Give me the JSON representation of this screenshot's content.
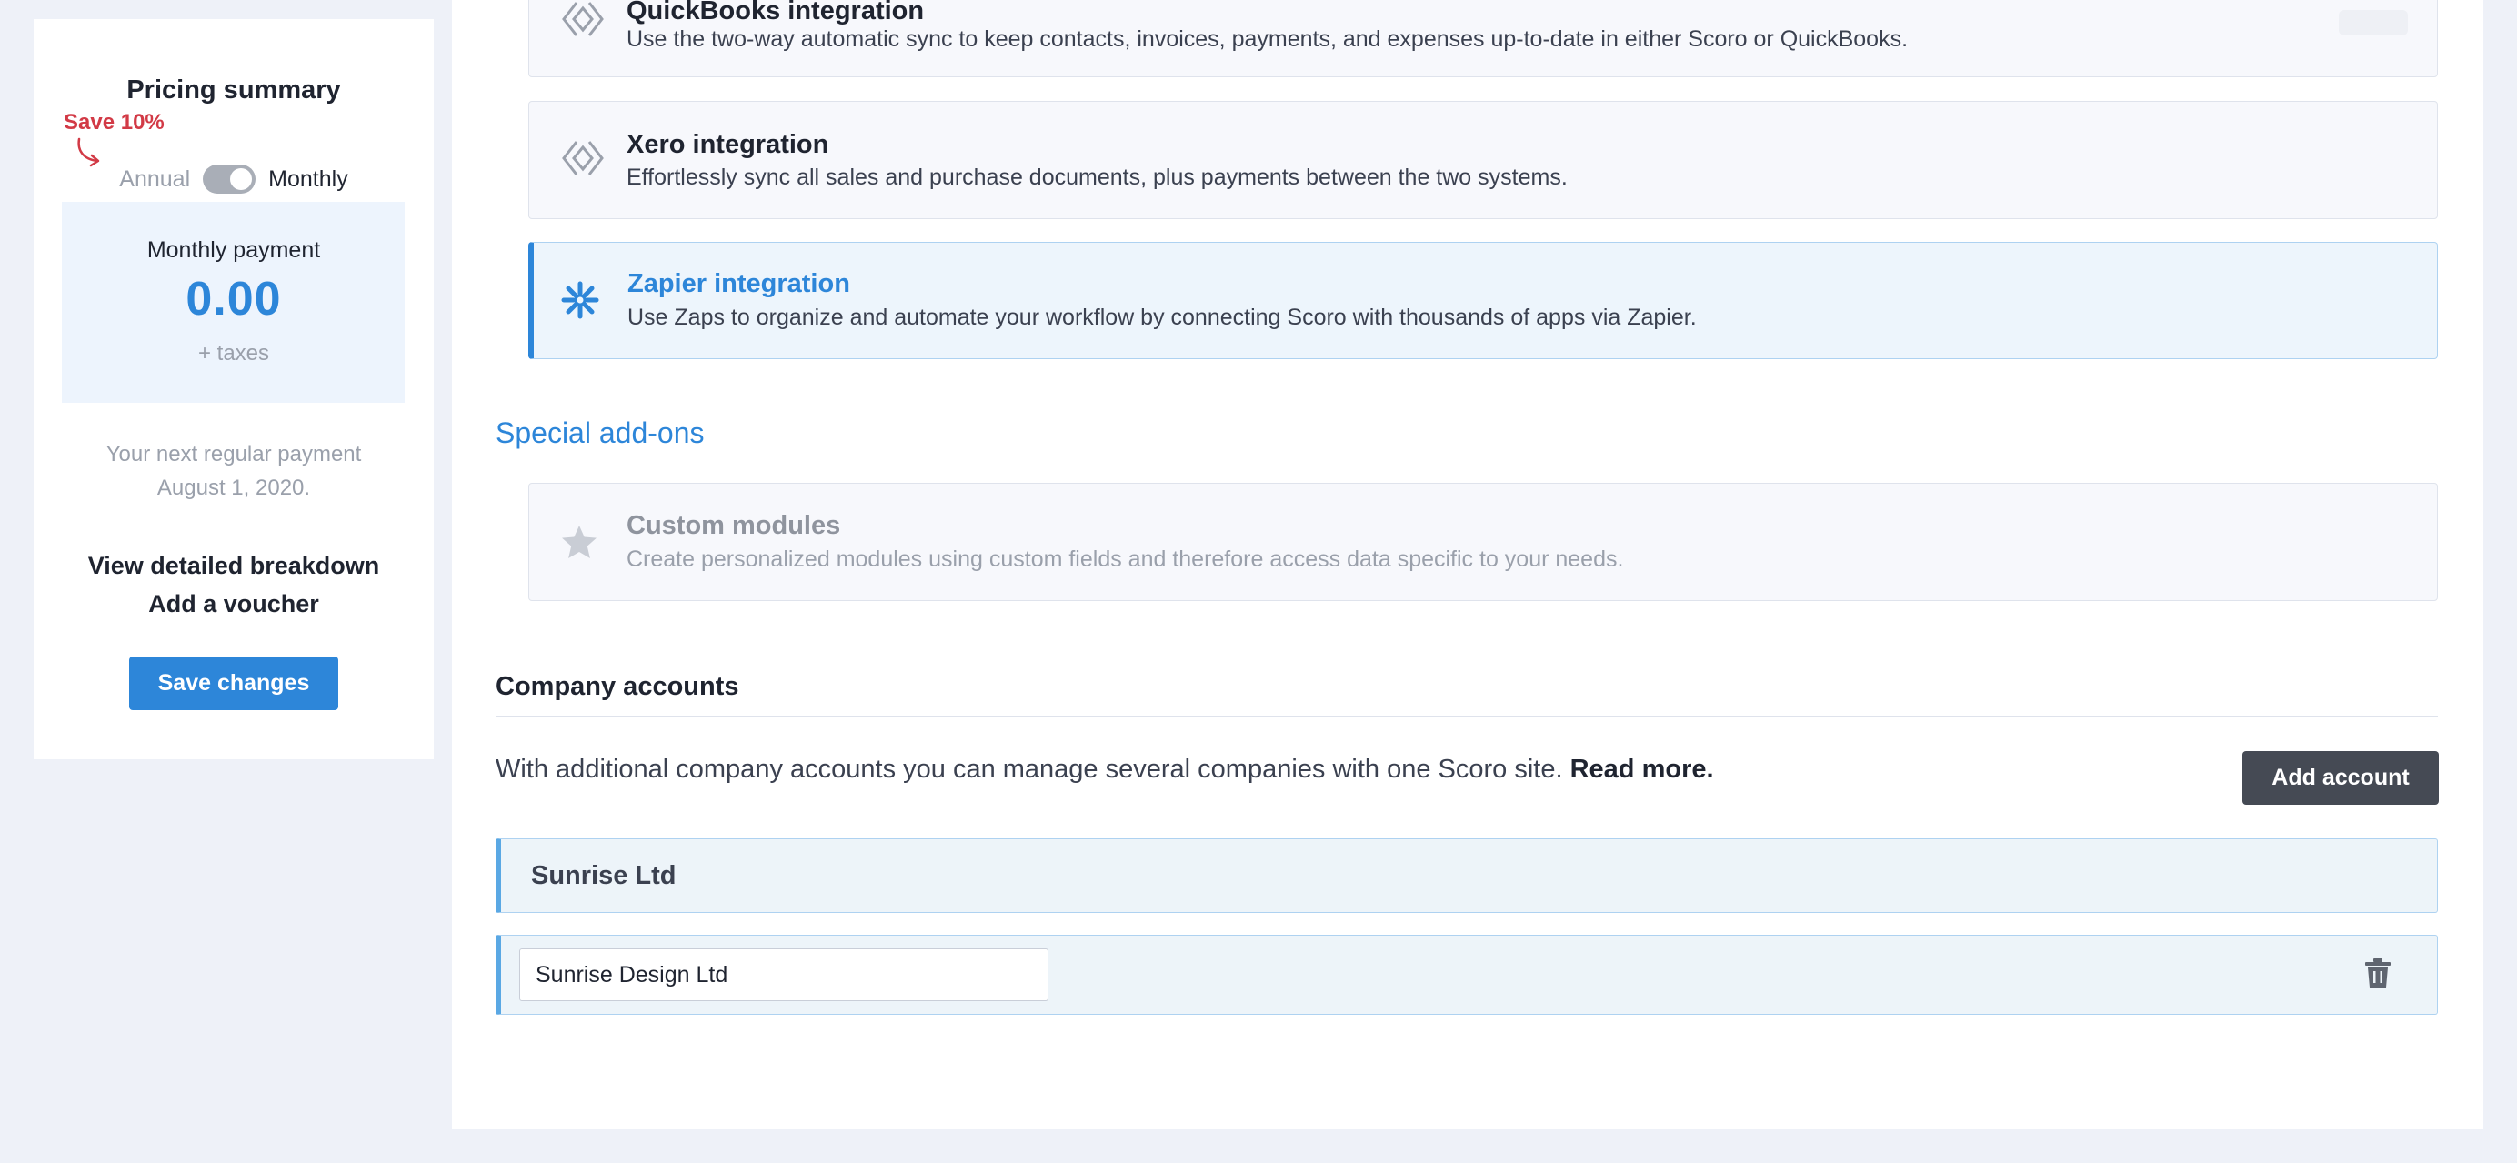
{
  "pricing": {
    "title": "Pricing summary",
    "save_badge": "Save 10%",
    "billing_annual": "Annual",
    "billing_monthly": "Monthly",
    "billing_selected": "Monthly",
    "payment_label": "Monthly payment",
    "payment_amount": "0.00",
    "payment_taxes": "+ taxes",
    "next_payment_line1": "Your next regular payment",
    "next_payment_line2": "August 1, 2020.",
    "breakdown_link": "View detailed breakdown",
    "voucher_link": "Add a voucher",
    "save_button": "Save changes"
  },
  "integrations": [
    {
      "title": "QuickBooks integration",
      "description": "Use the two-way automatic sync to keep contacts, invoices, payments, and expenses up-to-date in either Scoro or QuickBooks.",
      "icon": "diamond-sync-icon"
    },
    {
      "title": "Xero integration",
      "description": "Effortlessly sync all sales and purchase documents, plus payments between the two systems.",
      "icon": "diamond-sync-icon"
    },
    {
      "title": "Zapier integration",
      "description": "Use Zaps to organize and automate your workflow by connecting Scoro with thousands of apps via Zapier.",
      "icon": "asterisk-icon",
      "selected": true
    }
  ],
  "special_addons": {
    "heading": "Special add-ons",
    "items": [
      {
        "title": "Custom modules",
        "description": "Create personalized modules using custom fields and therefore access data specific to your needs.",
        "icon": "star-icon",
        "disabled": true
      }
    ]
  },
  "company_accounts": {
    "heading": "Company accounts",
    "description": "With additional company accounts you can manage several companies with one Scoro site.",
    "read_more": "Read more.",
    "add_button": "Add account",
    "group_name": "Sunrise Ltd",
    "entry_value": "Sunrise Design Ltd"
  },
  "colors": {
    "accent": "#2d86d9",
    "save_badge": "#d23a46",
    "dark_button": "#454a54",
    "background": "#eef1f8"
  }
}
